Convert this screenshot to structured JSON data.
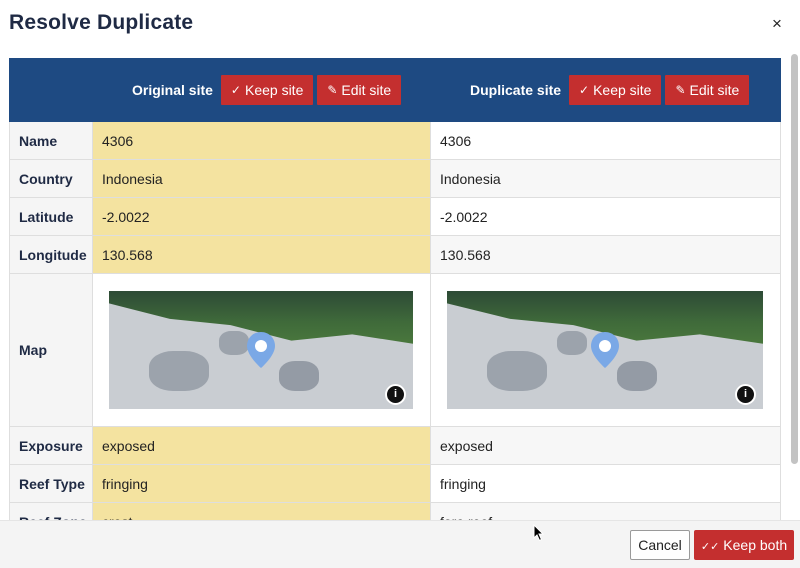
{
  "dialog": {
    "title": "Resolve Duplicate",
    "close_icon": "×"
  },
  "header": {
    "original_label": "Original site",
    "duplicate_label": "Duplicate site",
    "keep_site": "Keep site",
    "edit_site": "Edit site",
    "check_icon": "✓",
    "pencil_icon": "✎"
  },
  "rows": [
    {
      "label": "Name",
      "original": "4306",
      "duplicate": "4306"
    },
    {
      "label": "Country",
      "original": "Indonesia",
      "duplicate": "Indonesia"
    },
    {
      "label": "Latitude",
      "original": "-2.0022",
      "duplicate": "-2.0022"
    },
    {
      "label": "Longitude",
      "original": "130.568",
      "duplicate": "130.568"
    },
    {
      "label": "Map"
    },
    {
      "label": "Exposure",
      "original": "exposed",
      "duplicate": "exposed"
    },
    {
      "label": "Reef Type",
      "original": "fringing",
      "duplicate": "fringing"
    },
    {
      "label": "Reef Zone",
      "original": "crest",
      "duplicate": "fore reef"
    }
  ],
  "map_info_icon": "i",
  "footer": {
    "cancel": "Cancel",
    "keep_both": "Keep both",
    "double_check_icon": "✓✓"
  },
  "colors": {
    "header_bg": "#1e4a82",
    "button_red": "#c42f2f",
    "original_highlight": "#f4e3a0",
    "title_color": "#1f2a44"
  }
}
